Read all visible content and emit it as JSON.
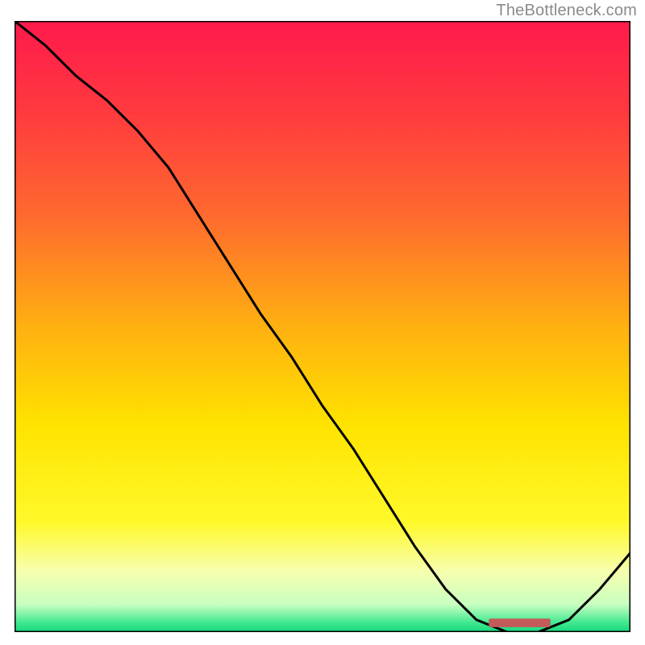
{
  "attribution": "TheBottleneck.com",
  "chart_data": {
    "type": "line",
    "title": "",
    "xlabel": "",
    "ylabel": "",
    "xlim": [
      0,
      100
    ],
    "ylim": [
      0,
      100
    ],
    "x": [
      0,
      5,
      10,
      15,
      20,
      25,
      30,
      35,
      40,
      45,
      50,
      55,
      60,
      65,
      70,
      75,
      80,
      85,
      90,
      95,
      100
    ],
    "values": [
      100,
      96,
      91,
      87,
      82,
      76,
      68,
      60,
      52,
      45,
      37,
      30,
      22,
      14,
      7,
      2,
      0,
      0,
      2,
      7,
      13
    ],
    "background_gradient": [
      {
        "offset": 0.0,
        "color": "#ff1a4b"
      },
      {
        "offset": 0.15,
        "color": "#ff3a3f"
      },
      {
        "offset": 0.32,
        "color": "#ff6a2e"
      },
      {
        "offset": 0.5,
        "color": "#ffb011"
      },
      {
        "offset": 0.66,
        "color": "#ffe300"
      },
      {
        "offset": 0.82,
        "color": "#fff92a"
      },
      {
        "offset": 0.9,
        "color": "#f7ffae"
      },
      {
        "offset": 0.955,
        "color": "#c8ffc0"
      },
      {
        "offset": 0.985,
        "color": "#3fe890"
      },
      {
        "offset": 1.0,
        "color": "#15d77a"
      }
    ],
    "marker": {
      "x_start": 77,
      "x_end": 87,
      "y": 0.8,
      "height": 1.4,
      "color": "#c45a5a"
    }
  }
}
